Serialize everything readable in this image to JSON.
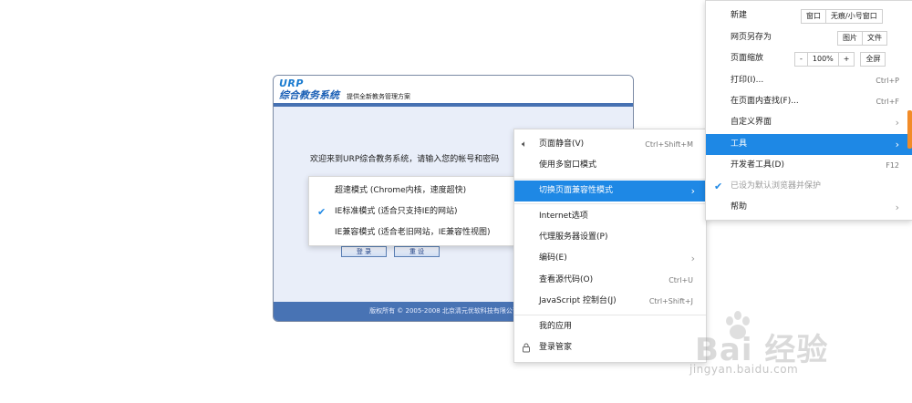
{
  "urp": {
    "logo_top": "URP",
    "logo_main": "综合教务系统",
    "slogan": "提供全新教务管理方案",
    "welcome": "欢迎来到URP综合教务系统，请输入您的帐号和密码",
    "login_button": "登 录",
    "reset_button": "重 设",
    "footer": "版权所有 © 2005-2008 北京清元优软科技有限公司"
  },
  "compat_menu": {
    "items": [
      {
        "label": "超速模式 (Chrome内核，速度超快)",
        "checked": false
      },
      {
        "label": "IE标准模式 (适合只支持IE的网站)",
        "checked": true
      },
      {
        "label": "IE兼容模式 (适合老旧网站，IE兼容性视图)",
        "checked": false
      }
    ]
  },
  "tools_menu": {
    "mute": {
      "label": "页面静音(V)",
      "shortcut": "Ctrl+Shift+M",
      "icon": "speaker-icon"
    },
    "multi_window": {
      "label": "使用多窗口模式"
    },
    "compat_mode": {
      "label": "切换页面兼容性模式"
    },
    "internet_options": {
      "label": "Internet选项"
    },
    "proxy": {
      "label": "代理服务器设置(P)"
    },
    "encoding": {
      "label": "编码(E)"
    },
    "view_source": {
      "label": "查看源代码(O)",
      "shortcut": "Ctrl+U"
    },
    "js_console": {
      "label": "JavaScript 控制台(J)",
      "shortcut": "Ctrl+Shift+J"
    },
    "my_apps": {
      "label": "我的应用"
    },
    "login_manager": {
      "label": "登录管家",
      "icon": "lock-icon"
    }
  },
  "main_menu": {
    "new": {
      "label": "新建",
      "buttons": [
        "窗口",
        "无痕/小号窗口"
      ]
    },
    "save_as": {
      "label": "网页另存为",
      "buttons": [
        "图片",
        "文件"
      ]
    },
    "zoom": {
      "label": "页面缩放",
      "minus": "-",
      "value": "100%",
      "plus": "+",
      "fullscreen": "全屏"
    },
    "print": {
      "label": "打印(I)...",
      "shortcut": "Ctrl+P"
    },
    "find": {
      "label": "在页面内查找(F)...",
      "shortcut": "Ctrl+F"
    },
    "customize": {
      "label": "自定义界面"
    },
    "tools": {
      "label": "工具"
    },
    "devtools": {
      "label": "开发者工具(D)",
      "shortcut": "F12"
    },
    "default_browser": {
      "label": "已设为默认浏览器并保护"
    },
    "help": {
      "label": "帮助"
    }
  },
  "colors": {
    "highlight": "#1e88e5",
    "urp_bar": "#4671b2",
    "scroll_thumb": "#f28c28"
  },
  "watermark": {
    "brand": "Bai 经验",
    "url": "jingyan.baidu.com"
  }
}
